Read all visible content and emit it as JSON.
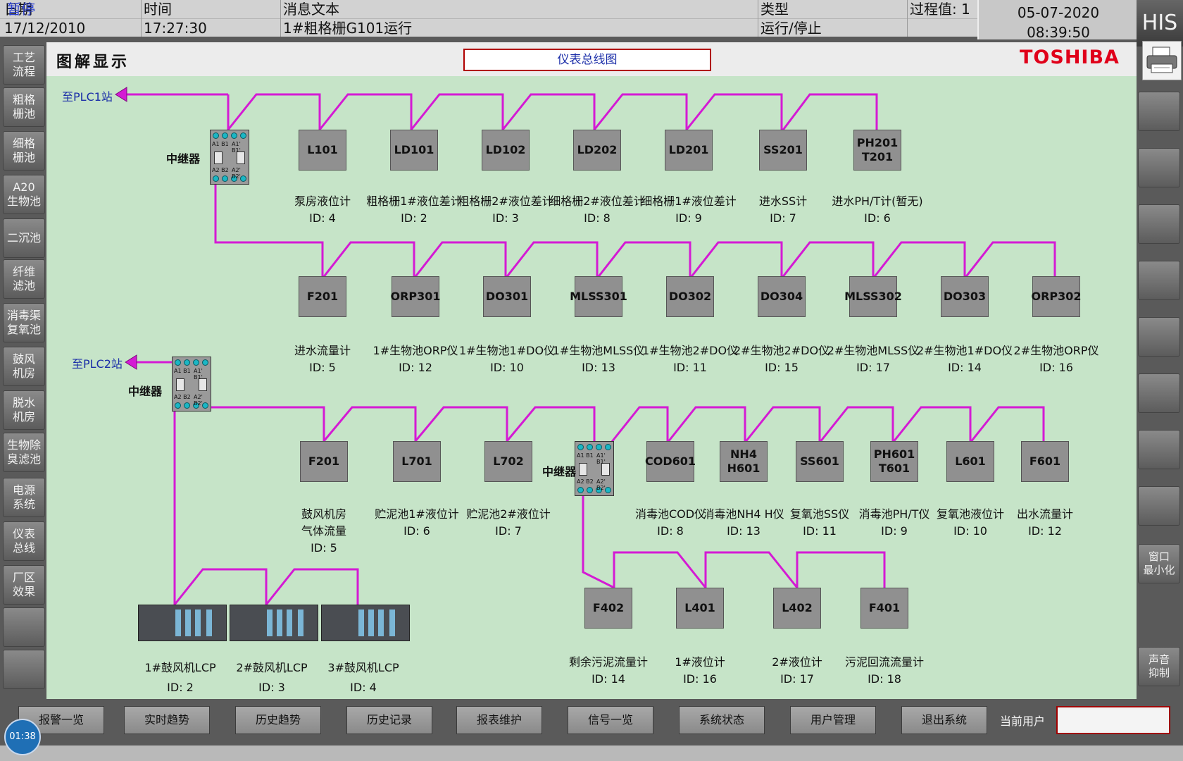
{
  "top_bar": {
    "headers": {
      "date": "日期",
      "time": "时间",
      "message": "消息文本",
      "type": "类型",
      "process_value_label": "过程值:",
      "process_value": "1"
    },
    "status_overlay": "暂停",
    "row": {
      "date": "17/12/2010",
      "time": "17:27:30",
      "message": "1#粗格栅G101运行",
      "type": "运行/停止"
    },
    "current_date": "05-07-2020",
    "current_time": "08:39:50",
    "his_label": "HIS"
  },
  "left_nav": [
    "工艺\n流程",
    "粗格\n栅池",
    "细格\n栅池",
    "A20\n生物池",
    "二沉池",
    "纤维\n滤池",
    "消毒渠\n复氧池",
    "鼓风\n机房",
    "脱水\n机房",
    "生物除\n臭滤池",
    "电源\n系统",
    "仪表\n总线",
    "厂区\n效果",
    "",
    ""
  ],
  "right_nav": {
    "minimize": "窗口\n最小化",
    "sound": "声音\n抑制"
  },
  "header": {
    "page_title": "图解显示",
    "diagram_title": "仪表总线图",
    "brand": "TOSHIBA"
  },
  "plc_labels": {
    "plc1": "至PLC1站",
    "plc2": "至PLC2站"
  },
  "repeater_label": "中继器",
  "repeater_text": {
    "tl": "A1 B1",
    "tr": "A1' B1'",
    "bl": "A2 B2",
    "br": "A2' B2'"
  },
  "row1": [
    {
      "tag": "L101",
      "name": "泵房液位计",
      "id": "ID: 4"
    },
    {
      "tag": "LD101",
      "name": "粗格栅1#液位差计",
      "id": "ID: 2"
    },
    {
      "tag": "LD102",
      "name": "粗格栅2#液位差计",
      "id": "ID: 3"
    },
    {
      "tag": "LD202",
      "name": "细格栅2#液位差计",
      "id": "ID: 8"
    },
    {
      "tag": "LD201",
      "name": "细格栅1#液位差计",
      "id": "ID: 9"
    },
    {
      "tag": "SS201",
      "name": "进水SS计",
      "id": "ID: 7"
    },
    {
      "tag": "PH201\nT201",
      "name": "进水PH/T计(暂无)",
      "id": "ID: 6"
    }
  ],
  "row2": [
    {
      "tag": "F201",
      "name": "进水流量计",
      "id": "ID: 5"
    },
    {
      "tag": "ORP301",
      "name": "1#生物池ORP仪",
      "id": "ID: 12"
    },
    {
      "tag": "DO301",
      "name": "1#生物池1#DO仪",
      "id": "ID: 10"
    },
    {
      "tag": "MLSS301",
      "name": "1#生物池MLSS仪",
      "id": "ID: 13"
    },
    {
      "tag": "DO302",
      "name": "1#生物池2#DO仪",
      "id": "ID: 11"
    },
    {
      "tag": "DO304",
      "name": "2#生物池2#DO仪",
      "id": "ID: 15"
    },
    {
      "tag": "MLSS302",
      "name": "2#生物池MLSS仪",
      "id": "ID: 17"
    },
    {
      "tag": "DO303",
      "name": "2#生物池1#DO仪",
      "id": "ID: 14"
    },
    {
      "tag": "ORP302",
      "name": "2#生物池ORP仪",
      "id": "ID: 16"
    }
  ],
  "row3": [
    {
      "tag": "F201",
      "name": "鼓风机房\n气体流量",
      "id": "ID: 5"
    },
    {
      "tag": "L701",
      "name": "贮泥池1#液位计",
      "id": "ID: 6"
    },
    {
      "tag": "L702",
      "name": "贮泥池2#液位计",
      "id": "ID: 7"
    },
    {
      "tag": "COD601",
      "name": "消毒池COD仪",
      "id": "ID: 8"
    },
    {
      "tag": "NH4 H601",
      "name": "消毒池NH4 H仪",
      "id": "ID: 13"
    },
    {
      "tag": "SS601",
      "name": "复氧池SS仪",
      "id": "ID: 11"
    },
    {
      "tag": "PH601\nT601",
      "name": "消毒池PH/T仪",
      "id": "ID: 9"
    },
    {
      "tag": "L601",
      "name": "复氧池液位计",
      "id": "ID: 10"
    },
    {
      "tag": "F601",
      "name": "出水流量计",
      "id": "ID: 12"
    }
  ],
  "row4": [
    {
      "tag": "F402",
      "name": "剩余污泥流量计",
      "id": "ID: 14"
    },
    {
      "tag": "L401",
      "name": "1#液位计",
      "id": "ID: 16"
    },
    {
      "tag": "L402",
      "name": "2#液位计",
      "id": "ID: 17"
    },
    {
      "tag": "F401",
      "name": "污泥回流流量计",
      "id": "ID: 18"
    }
  ],
  "lcp": [
    {
      "name": "1#鼓风机LCP",
      "id": "ID: 2"
    },
    {
      "name": "2#鼓风机LCP",
      "id": "ID: 3"
    },
    {
      "name": "3#鼓风机LCP",
      "id": "ID: 4"
    }
  ],
  "bottom_buttons": [
    "报警一览",
    "实时趋势",
    "历史趋势",
    "历史记录",
    "报表维护",
    "信号一览",
    "系统状态",
    "用户管理",
    "退出系统"
  ],
  "current_user_label": "当前用户",
  "clock": "01:38",
  "colors": {
    "bus": "#d41ad4",
    "panel": "#c6e4c8",
    "brand": "#e0001a"
  }
}
